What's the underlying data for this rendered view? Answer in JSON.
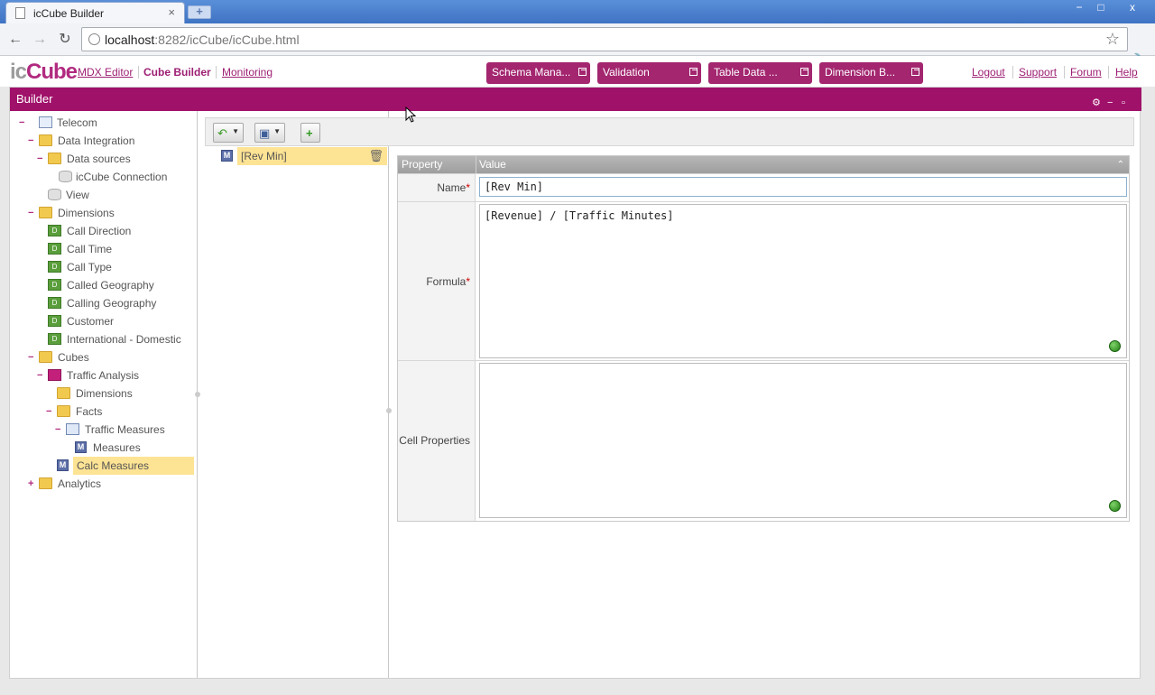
{
  "browser": {
    "tab_title": "icCube Builder",
    "tab_close": "×",
    "new_tab": "+",
    "url_host": "localhost",
    "url_rest": ":8282/icCube/icCube.html",
    "window_buttons": {
      "minimize": "−",
      "maximize": "□",
      "close": "x"
    }
  },
  "app": {
    "logo_ic": "ic",
    "logo_cube": "Cube",
    "nav": {
      "mdx_editor": "MDX Editor",
      "cube_builder": "Cube Builder",
      "monitoring": "Monitoring"
    },
    "pills": {
      "schema": "Schema Mana...",
      "validation": "Validation",
      "table_data": "Table Data ...",
      "dimension": "Dimension B..."
    },
    "links": {
      "logout": "Logout",
      "support": "Support",
      "forum": "Forum",
      "help": "Help"
    }
  },
  "panel": {
    "title": "Builder",
    "tools": {
      "gear": "⚙",
      "minimize": "−",
      "maximize": "▫"
    }
  },
  "tree": {
    "telecom": "Telecom",
    "data_integration": "Data Integration",
    "data_sources": "Data sources",
    "iccube_connection": "icCube Connection",
    "view": "View",
    "dimensions": "Dimensions",
    "dim_items": [
      "Call Direction",
      "Call Time",
      "Call Type",
      "Called Geography",
      "Calling Geography",
      "Customer",
      "International - Domestic"
    ],
    "cubes": "Cubes",
    "traffic_analysis": "Traffic Analysis",
    "cube_dimensions": "Dimensions",
    "facts": "Facts",
    "traffic_measures": "Traffic Measures",
    "measures": "Measures",
    "calc_measures": "Calc Measures",
    "analytics": "Analytics",
    "toggles": {
      "open": "−",
      "closed": "+"
    }
  },
  "list": {
    "items": [
      "[Rev Min]"
    ]
  },
  "grid": {
    "header_property": "Property",
    "header_value": "Value",
    "collapse": "⌃",
    "rows": {
      "name_label": "Name",
      "name_value": "[Rev Min]",
      "formula_label": "Formula",
      "formula_value": "[Revenue] / [Traffic Minutes]",
      "cell_props_label": "Cell Properties",
      "cell_props_value": ""
    },
    "required_marker": "*"
  },
  "colors": {
    "brand": "#a0116a",
    "selection": "#fde394",
    "status_ok": "#2f9a1e"
  }
}
